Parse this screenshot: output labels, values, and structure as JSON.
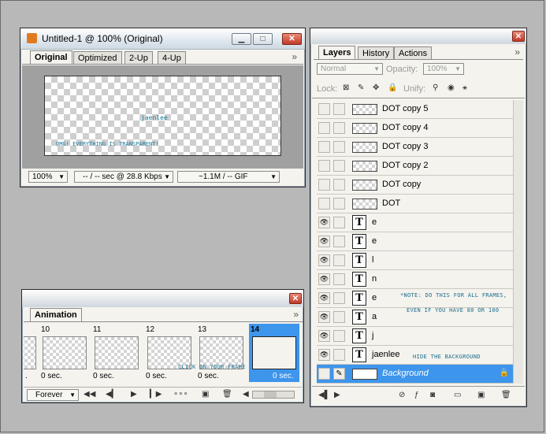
{
  "doc_window": {
    "title": "Untitled-1 @ 100% (Original)",
    "tabs": [
      "Original",
      "Optimized",
      "2-Up",
      "4-Up"
    ],
    "canvas_texts": {
      "name": "jaenlee",
      "caption": "OMG! EVERYTHING IS TRANSPARENT!"
    },
    "status": {
      "zoom": "100%",
      "speed": "-- / -- sec @ 28.8 Kbps",
      "size": "~1.1M / -- GIF"
    },
    "menu_arrow": "»"
  },
  "animation_panel": {
    "tab": "Animation",
    "menu_arrow": "»",
    "frames": [
      {
        "num": "",
        "time": "."
      },
      {
        "num": "10",
        "time": "0 sec."
      },
      {
        "num": "11",
        "time": "0 sec."
      },
      {
        "num": "12",
        "time": "0 sec."
      },
      {
        "num": "13",
        "time": "0 sec."
      },
      {
        "num": "14",
        "time": "0 sec."
      }
    ],
    "note": "CLICK ON YOUR FRAME",
    "loop": "Forever"
  },
  "layers_panel": {
    "tabs": [
      "Layers",
      "History",
      "Actions"
    ],
    "menu_arrow": "»",
    "blend_mode": "Normal",
    "opacity_label": "Opacity:",
    "opacity_value": "100%",
    "lock_label": "Lock:",
    "unify_label": "Unify:",
    "layers": [
      {
        "name": "DOT copy 5",
        "kind": "image",
        "visible": false
      },
      {
        "name": "DOT copy 4",
        "kind": "image",
        "visible": false
      },
      {
        "name": "DOT copy 3",
        "kind": "image",
        "visible": false
      },
      {
        "name": "DOT copy 2",
        "kind": "image",
        "visible": false
      },
      {
        "name": "DOT copy",
        "kind": "image",
        "visible": false
      },
      {
        "name": "DOT",
        "kind": "image",
        "visible": false
      },
      {
        "name": "e",
        "kind": "text",
        "visible": true
      },
      {
        "name": "e",
        "kind": "text",
        "visible": true
      },
      {
        "name": "l",
        "kind": "text",
        "visible": true
      },
      {
        "name": "n",
        "kind": "text",
        "visible": true
      },
      {
        "name": "e",
        "kind": "text",
        "visible": true
      },
      {
        "name": "a",
        "kind": "text",
        "visible": true
      },
      {
        "name": "j",
        "kind": "text",
        "visible": true
      },
      {
        "name": "jaenlee",
        "kind": "text",
        "visible": true
      },
      {
        "name": "Background",
        "kind": "background",
        "visible": false,
        "selected": true
      }
    ],
    "notes": {
      "note1": "*NOTE: DO THIS FOR ALL FRAMES,",
      "note2": "EVEN IF YOU HAVE 80 OR 100",
      "note3": "HIDE THE BACKGROUND"
    }
  },
  "colors": {
    "selection": "#3d95ec",
    "note_text": "#1b6d8c",
    "close_red": "#c4382a"
  }
}
